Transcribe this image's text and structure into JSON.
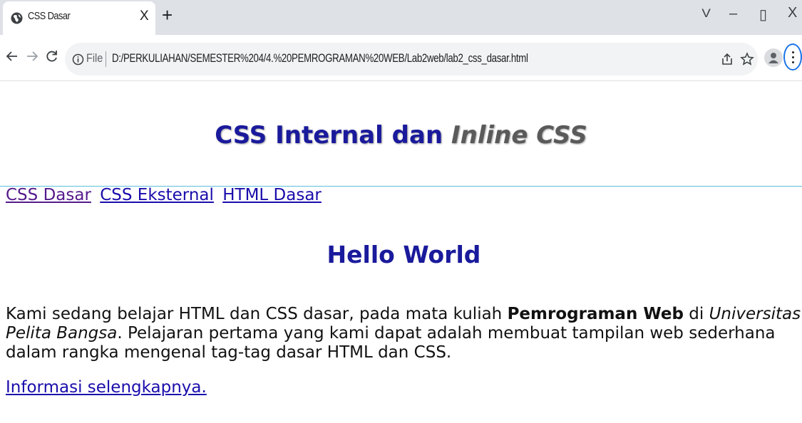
{
  "browser": {
    "tab": {
      "title": "CSS Dasar",
      "close": "X"
    },
    "new_tab": "+",
    "window": {
      "dropdown": "V",
      "minimize": "–",
      "restore": "▯",
      "close": "X"
    },
    "omnibox": {
      "scheme": "File",
      "url": "D:/PERKULIAHAN/SEMESTER%204/4.%20PEMROGRAMAN%20WEB/Lab2web/lab2_css_dasar.html"
    }
  },
  "page": {
    "title": {
      "main": "CSS Internal dan ",
      "italic": "Inline CSS"
    },
    "nav": [
      {
        "label": "CSS Dasar",
        "visited": true
      },
      {
        "label": "CSS Eksternal",
        "visited": false
      },
      {
        "label": "HTML Dasar",
        "visited": false
      }
    ],
    "heading": "Hello World",
    "paragraph": {
      "part1": "Kami sedang belajar HTML dan CSS dasar, pada mata kuliah ",
      "bold": "Pemrograman Web",
      "part2": " di ",
      "italic": "Universitas Pelita Bangsa",
      "part3": ". Pelajaran pertama yang kami dapat adalah membuat tampilan web sederhana dalam rangka mengenal tag-tag dasar HTML dan CSS."
    },
    "more_link": "Informasi selengkapnya."
  },
  "colors": {
    "heading": "#1a1a9c",
    "title_italic": "#5a5a5a",
    "link": "#1a0dab",
    "visited_link": "#551a8b",
    "hr": "#5bc0de"
  },
  "icons": {
    "tab_favicon": "globe-icon",
    "back": "back-arrow-icon",
    "forward": "forward-arrow-icon",
    "reload": "reload-icon",
    "info": "info-icon",
    "share": "share-icon",
    "bookmark": "star-icon",
    "profile": "profile-icon",
    "menu": "kebab-menu-icon"
  }
}
